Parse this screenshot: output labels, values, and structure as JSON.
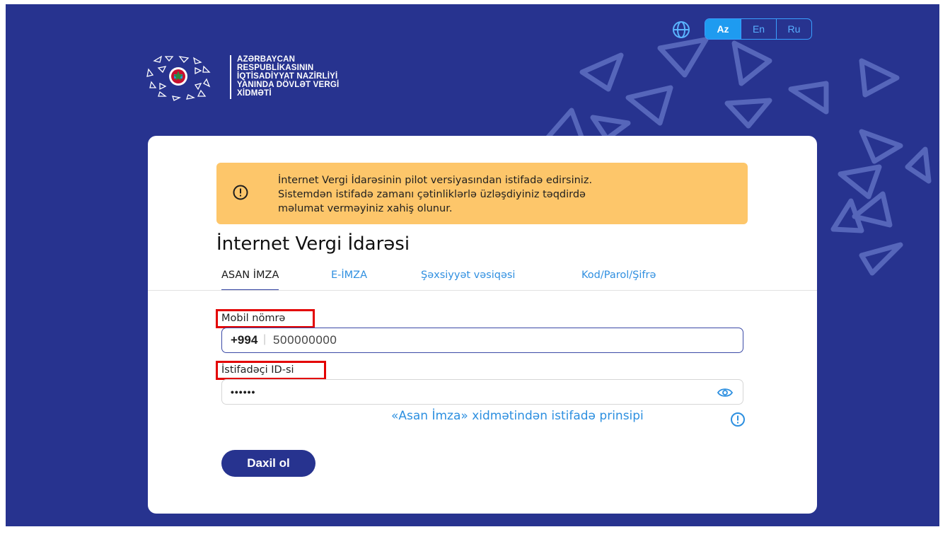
{
  "header": {
    "logo_lines": [
      "AZƏRBAYCAN",
      "RESPUBLİKASININ",
      "İQTİSADİYYAT NAZİRLİYİ",
      "YANINDA DÖVLƏT VERGİ",
      "XİDMƏTİ"
    ],
    "languages": [
      {
        "label": "Az",
        "active": true
      },
      {
        "label": "En",
        "active": false
      },
      {
        "label": "Ru",
        "active": false
      }
    ]
  },
  "alert": {
    "icon": "exclamation-circle-icon",
    "lines": [
      "İnternet Vergi İdarəsinin pilot versiyasından istifadə edirsiniz.",
      "Sistemdən istifadə zamanı çətinliklərlə üzləşdiyiniz təqdirdə",
      "məlumat verməyiniz xahiş olunur."
    ]
  },
  "title": "İnternet Vergi İdarəsi",
  "tabs": [
    {
      "label": "ASAN İMZA",
      "active": true
    },
    {
      "label": "E-İMZA",
      "active": false
    },
    {
      "label": "Şəxsiyyət vəsiqəsi",
      "active": false
    },
    {
      "label": "Kod/Parol/Şifrə",
      "active": false
    }
  ],
  "form": {
    "phone_label": "Mobil nömrə",
    "phone_prefix": "+994",
    "phone_separator": "|",
    "phone_value": "500000000",
    "id_label": "İstifadəçi ID-si",
    "id_value": "••••••",
    "principle_link": "«Asan İmza» xidmətindən istifadə prinsipi",
    "submit_label": "Daxil ol"
  },
  "colors": {
    "background": "#27338f",
    "alert_bg": "#fdc66a",
    "accent_blue": "#2c8fe0",
    "highlight": "#e30000"
  }
}
